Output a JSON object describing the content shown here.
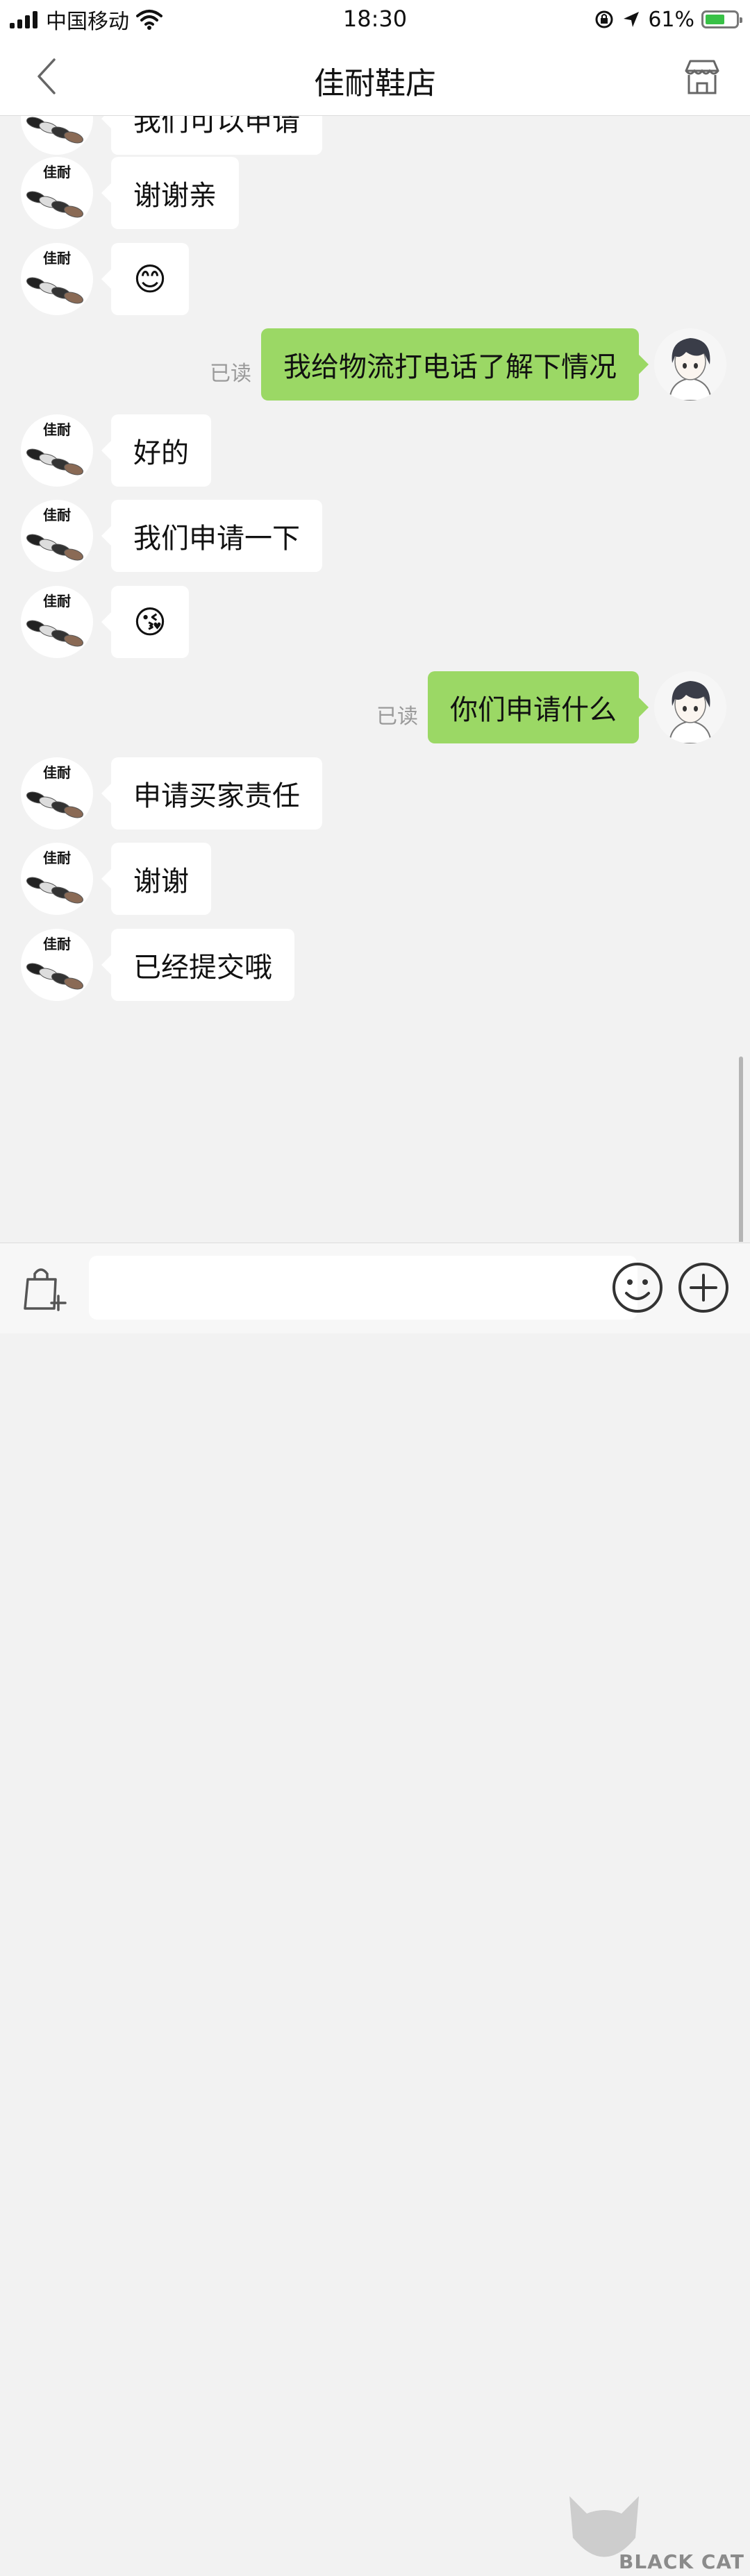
{
  "status_bar": {
    "carrier": "中国移动",
    "time": "18:30",
    "battery": "61%",
    "battery_level": 0.61
  },
  "header": {
    "title": "佳耐鞋店",
    "back_icon": "chevron-left-icon",
    "shop_icon": "storefront-icon"
  },
  "chat": {
    "shop_avatar_label": "佳耐",
    "read_label": "已读",
    "messages": [
      {
        "side": "in",
        "text": "我们可以申请"
      },
      {
        "side": "in",
        "text": "谢谢亲"
      },
      {
        "side": "in",
        "text": "😊"
      },
      {
        "side": "out",
        "text": "我给物流打电话了解下情况",
        "read": "已读"
      },
      {
        "side": "in",
        "text": "好的"
      },
      {
        "side": "in",
        "text": "我们申请一下"
      },
      {
        "side": "in",
        "text": "😘"
      },
      {
        "side": "out",
        "text": "你们申请什么",
        "read": "已读"
      },
      {
        "side": "in",
        "text": "申请买家责任"
      },
      {
        "side": "in",
        "text": "谢谢"
      },
      {
        "side": "in",
        "text": "已经提交哦"
      }
    ]
  },
  "input_bar": {
    "placeholder": "",
    "left_icon": "shopping-bag-add-icon",
    "emoji_icon": "smiley-icon",
    "plus_icon": "plus-circle-icon"
  },
  "watermark": {
    "text": "BLACK CAT"
  }
}
